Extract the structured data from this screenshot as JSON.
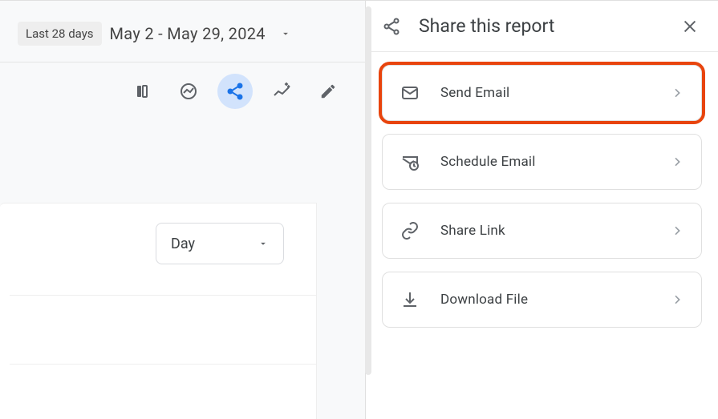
{
  "date_filter": {
    "label": "Last 28 days",
    "range": "May 2 - May 29, 2024"
  },
  "chart_dropdown": {
    "selected": "Day"
  },
  "panel": {
    "title": "Share this report"
  },
  "options": {
    "send_email": "Send Email",
    "schedule_email": "Schedule Email",
    "share_link": "Share Link",
    "download_file": "Download File"
  }
}
